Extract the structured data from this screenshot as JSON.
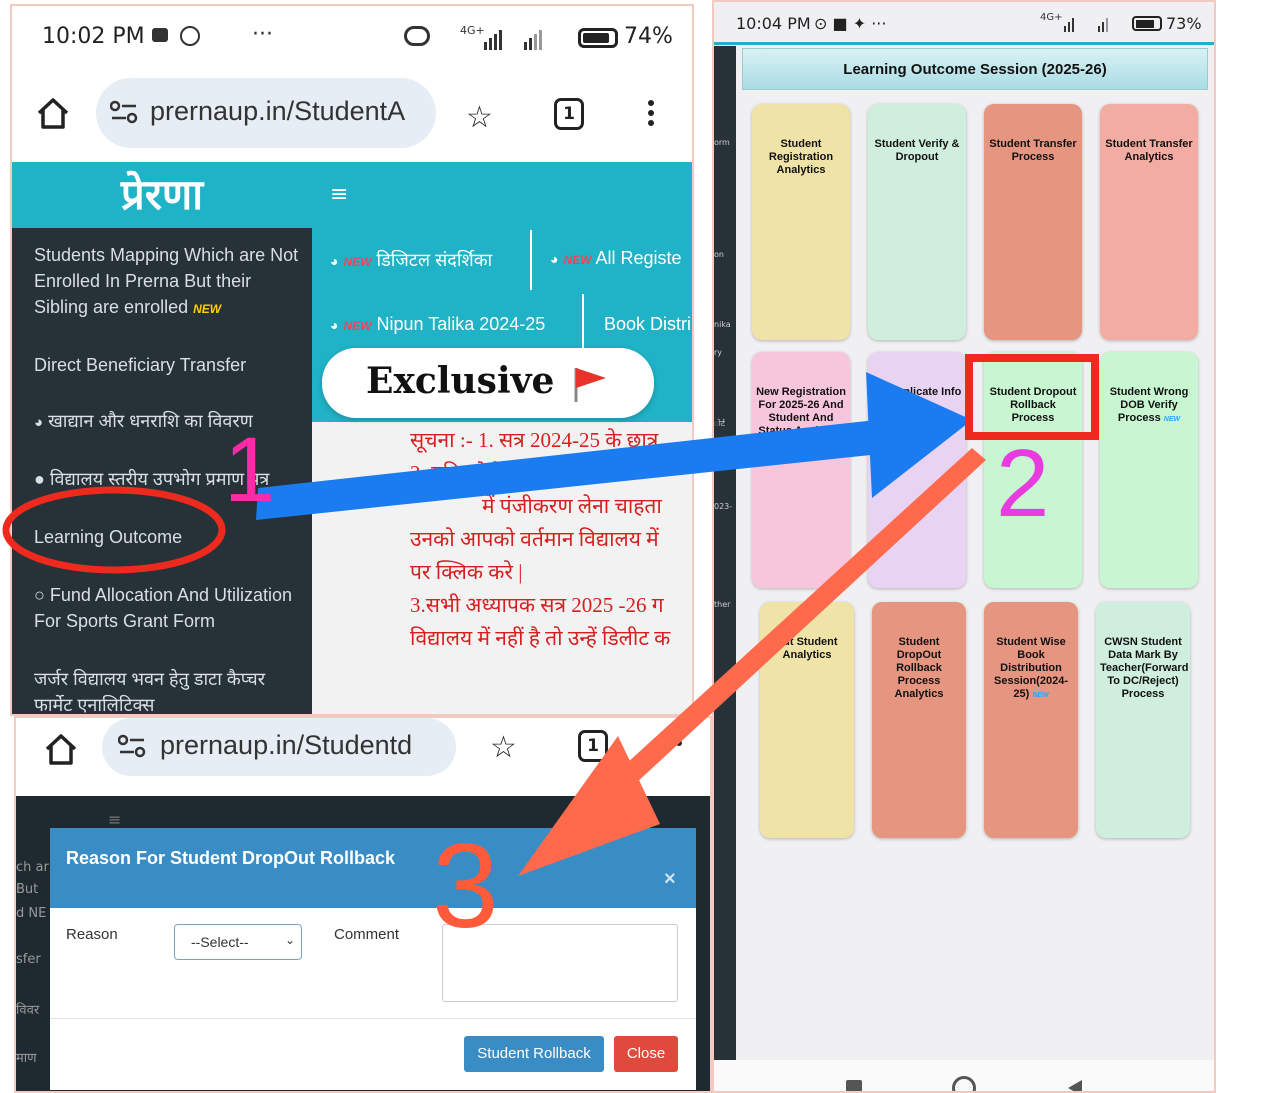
{
  "panel_a": {
    "status_time": "10:02 PM",
    "status_battery": "74%",
    "status_net": "4G+",
    "url": "prernaup.in/StudentA",
    "tab_count": "1",
    "brand": "प्रेरणा",
    "sidebar": {
      "items": [
        {
          "label": "Students Mapping Which are Not Enrolled In Prerna But their Sibling are enrolled"
        },
        {
          "label": "Direct Beneficiary Transfer"
        },
        {
          "label": "खाद्यान और धनराशि का विवरण"
        },
        {
          "label": "विद्यालय स्तरीय उपभोग प्रमाण पत्र"
        },
        {
          "label": "Learning Outcome"
        },
        {
          "label": "Fund Allocation And Utilization For Sports Grant Form"
        },
        {
          "label": "जर्जर विद्यालय भवन हेतु डाटा कैप्चर फार्मेट एनालिटिक्स"
        }
      ]
    },
    "new_tag": "NEW",
    "nav": {
      "links": [
        {
          "label": "डिजिटल संदर्शिका"
        },
        {
          "label": "All Registe"
        },
        {
          "label": "Nipun Talika 2024-25"
        },
        {
          "label": "Book Distri"
        }
      ]
    },
    "exclusive_badge": "Exclusive",
    "notice_lines": [
      "सूचना :- 1. सत्र 2024-25 के छात्र",
      "2. यदि कोई छात्र",
      "में पंजीकरण लेना चाहता",
      "उनको आपको वर्तमान विद्यालय में",
      "पर क्लिक करे |",
      "3.सभी अध्यापक सत्र 2025 -26 ग",
      "विद्यालय में नहीं है तो उन्हें डिलीट क"
    ]
  },
  "panel_b": {
    "status_time": "10:04 PM",
    "status_battery": "73%",
    "status_net": "4G+",
    "header": "Learning Outcome Session (2025-26)",
    "left_strip_labels": [
      "orm",
      "on",
      "nika",
      "ry",
      "ोर्ट",
      "023-",
      "ther"
    ],
    "tiles": [
      {
        "label": "Student Registration Analytics",
        "color": "#efe3a8"
      },
      {
        "label": "Student Verify & Dropout",
        "color": "#cfeedd"
      },
      {
        "label": "Student Transfer Process",
        "color": "#e69580"
      },
      {
        "label": "Student Transfer Analytics",
        "color": "#f3aca2"
      },
      {
        "label": "New Registration For 2025-26 And Student And Status Analytics",
        "color": "#f8c6dc"
      },
      {
        "label": "ch Duplicate Info",
        "color": "#e9d3f3"
      },
      {
        "label": "Student Dropout Rollback Process",
        "color": "#c8f6d1"
      },
      {
        "label": "Student Wrong DOB Verify Process",
        "color": "#c8f6d1"
      },
      {
        "label": "out Student Analytics",
        "color": "#efe3a8"
      },
      {
        "label": "Student DropOut Rollback Process Analytics",
        "color": "#e69580"
      },
      {
        "label": "Student Wise Book Distribution Session(2024-25)",
        "color": "#e69580"
      },
      {
        "label": "CWSN Student Data Mark By Teacher(Forward To DC/Reject) Process",
        "color": "#cfeedd"
      }
    ]
  },
  "panel_c": {
    "url": "prernaup.in/Studentd",
    "tab_count": "1",
    "modal_title": "Reason For Student DropOut Rollback",
    "close_x": "×",
    "reason_label": "Reason",
    "reason_select": "--Select--",
    "comment_label": "Comment",
    "rollback_button": "Student Rollback",
    "close_button": "Close",
    "bg_labels": [
      "ch ar",
      "But",
      "d NE",
      "sfer",
      "विवर",
      "माण"
    ]
  },
  "annotations": {
    "step1": "1",
    "step2": "2",
    "step3": "3",
    "arrow_blue": "#1a7cf0",
    "arrow_red": "#ff6a4d",
    "highlight_red": "#ee2a1e",
    "step_color_1": "#ff2aa7",
    "step_color_2": "#e83ce0",
    "step_color_3": "#ff5a3a"
  }
}
